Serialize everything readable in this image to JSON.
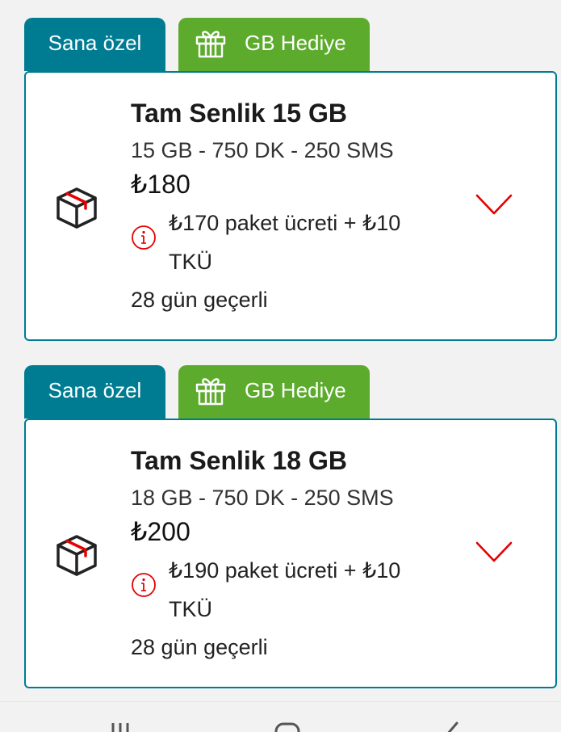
{
  "packages": [
    {
      "tab_special": "Sana özel",
      "tab_gift": "GB Hediye",
      "title": "Tam Senlik 15 GB",
      "specs": "15 GB - 750 DK - 250 SMS",
      "price": "₺180",
      "fee_text": "₺170 paket ücreti + ₺10 TKÜ",
      "validity": "28 gün geçerli"
    },
    {
      "tab_special": "Sana özel",
      "tab_gift": "GB Hediye",
      "title": "Tam Senlik 18 GB",
      "specs": "18 GB - 750 DK - 250 SMS",
      "price": "₺200",
      "fee_text": "₺190 paket ücreti + ₺10 TKÜ",
      "validity": "28 gün geçerli"
    }
  ],
  "colors": {
    "teal": "#007c92",
    "green": "#5cab2d",
    "red": "#e60000"
  },
  "icons": {
    "box": "package-box-icon",
    "info": "info-icon",
    "gift": "gift-icon",
    "expand": "chevron-down-icon",
    "nav_recents": "recent-apps-icon",
    "nav_home": "home-icon",
    "nav_back": "back-icon"
  }
}
